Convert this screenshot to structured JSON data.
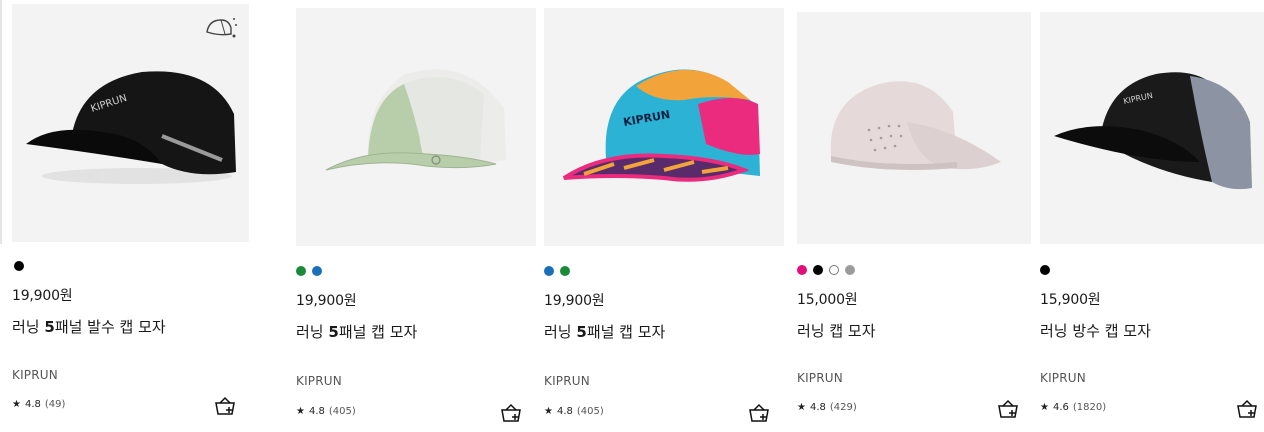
{
  "colors": {
    "image_bg": "#f3f3f3",
    "text": "#1a1a1a"
  },
  "products": [
    {
      "name_prefix": "러닝 ",
      "name_bold": "5",
      "name_suffix": "패널 발수 캡 모자",
      "price": "19,900원",
      "swatches": [
        "#000000"
      ],
      "brand": "KIPRUN",
      "rating": "4.8",
      "reviews": "(49)",
      "feature_icon": "water-repellent-icon"
    },
    {
      "name_prefix": "러닝 ",
      "name_bold": "5",
      "name_suffix": "패널 캡 모자",
      "price": "19,900원",
      "swatches": [
        "#1a8a3a",
        "#1a6fb8"
      ],
      "brand": "KIPRUN",
      "rating": "4.8",
      "reviews": "(405)"
    },
    {
      "name_prefix": "러닝 ",
      "name_bold": "5",
      "name_suffix": "패널 캡 모자",
      "price": "19,900원",
      "swatches": [
        "#1a6fb8",
        "#1a8a3a"
      ],
      "brand": "KIPRUN",
      "rating": "4.8",
      "reviews": "(405)"
    },
    {
      "name_prefix": "러닝 캡 모자",
      "name_bold": "",
      "name_suffix": "",
      "price": "15,000원",
      "swatches": [
        "#e0107a",
        "#000000",
        "#ffffff",
        "#9b9b9b"
      ],
      "brand": "KIPRUN",
      "rating": "4.8",
      "reviews": "(429)"
    },
    {
      "name_prefix": "러닝 방수 캡 모자",
      "name_bold": "",
      "name_suffix": "",
      "price": "15,900원",
      "swatches": [
        "#000000"
      ],
      "brand": "KIPRUN",
      "rating": "4.6",
      "reviews": "(1820)"
    }
  ],
  "icons": {
    "star": "★",
    "cart": "add-to-basket-icon"
  }
}
